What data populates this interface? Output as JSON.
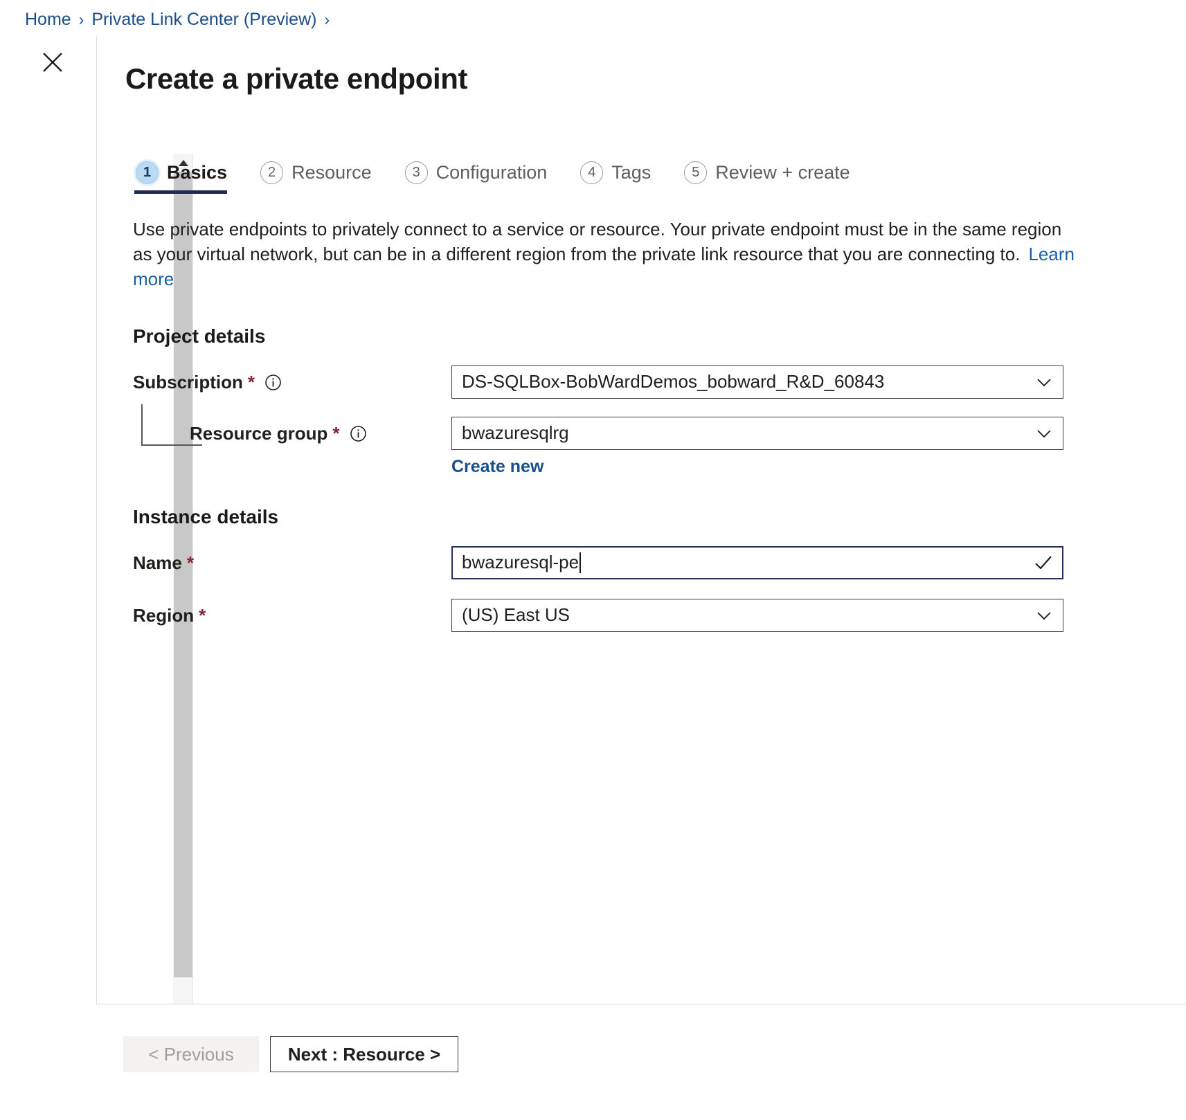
{
  "breadcrumb": {
    "items": [
      {
        "label": "Home"
      },
      {
        "label": "Private Link Center (Preview)"
      }
    ],
    "separator": "›"
  },
  "blade": {
    "close_label": "close-icon",
    "title": "Create a private endpoint"
  },
  "wizard": {
    "tabs": [
      {
        "number": "1",
        "label": "Basics",
        "active": true
      },
      {
        "number": "2",
        "label": "Resource",
        "active": false
      },
      {
        "number": "3",
        "label": "Configuration",
        "active": false
      },
      {
        "number": "4",
        "label": "Tags",
        "active": false
      },
      {
        "number": "5",
        "label": "Review + create",
        "active": false
      }
    ]
  },
  "description": {
    "text": "Use private endpoints to privately connect to a service or resource. Your private endpoint must be in the same region as your virtual network, but can be in a different region from the private link resource that you are connecting to.",
    "link_label": "Learn more"
  },
  "project_details": {
    "heading": "Project details",
    "subscription": {
      "label": "Subscription",
      "required_mark": "*",
      "value": "DS-SQLBox-BobWardDemos_bobward_R&D_60843"
    },
    "resource_group": {
      "label": "Resource group",
      "required_mark": "*",
      "value": "bwazuresqlrg",
      "create_new_label": "Create new"
    }
  },
  "instance_details": {
    "heading": "Instance details",
    "name": {
      "label": "Name",
      "required_mark": "*",
      "value": "bwazuresql-pe",
      "placeholder": "",
      "valid": true
    },
    "region": {
      "label": "Region",
      "required_mark": "*",
      "value": "(US) East US"
    }
  },
  "footer": {
    "previous_label": "< Previous",
    "next_label": "Next : Resource >"
  },
  "colors": {
    "link": "#1a4f8b",
    "accent_underline": "#1f2b57",
    "required": "#8a2433",
    "active_step_bg": "#bcd9f2",
    "valid_check": "#1b1a19"
  },
  "scrollbar": {
    "up_arrow": "scroll-up-arrow",
    "down_arrow": "scroll-down-arrow"
  }
}
